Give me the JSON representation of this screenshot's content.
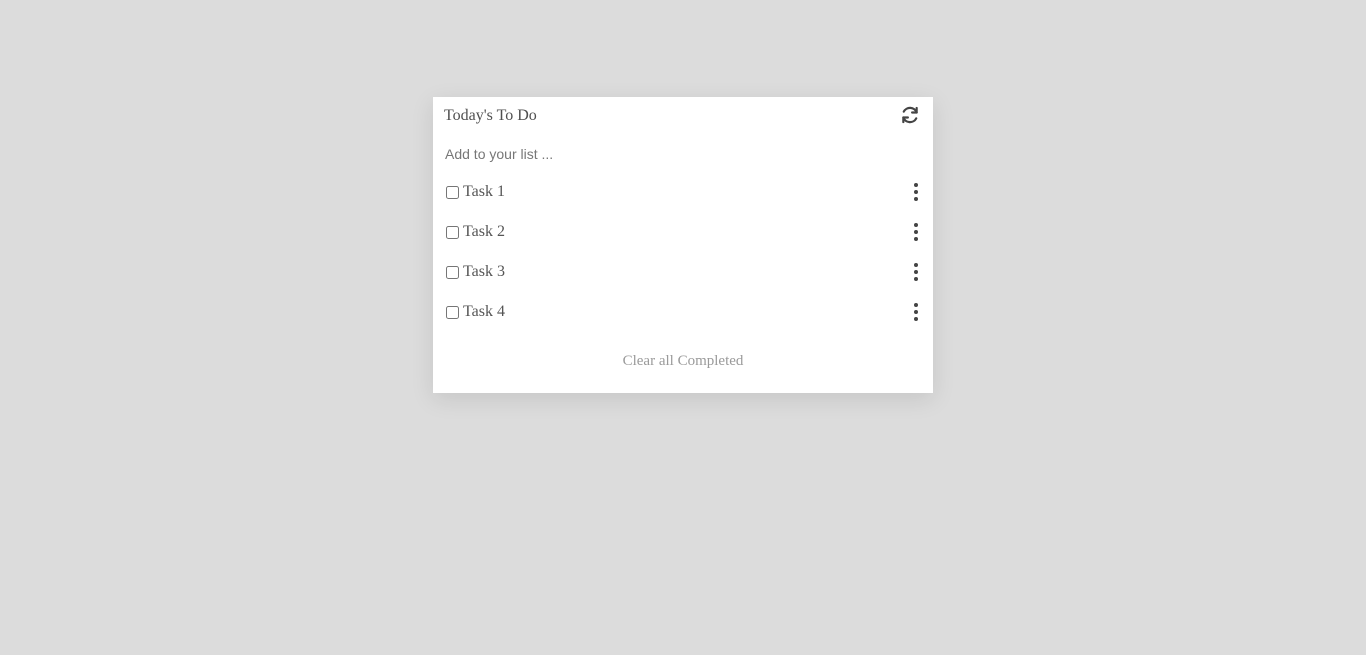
{
  "app": {
    "title": "Today's To Do",
    "refresh_icon": "refresh-icon"
  },
  "add": {
    "placeholder": "Add to your list ..."
  },
  "tasks": [
    {
      "label": "Task 1",
      "checked": false,
      "menu_icon": "kebab-menu-icon"
    },
    {
      "label": "Task 2",
      "checked": false,
      "menu_icon": "kebab-menu-icon"
    },
    {
      "label": "Task 3",
      "checked": false,
      "menu_icon": "kebab-menu-icon"
    },
    {
      "label": "Task 4",
      "checked": false,
      "menu_icon": "kebab-menu-icon"
    }
  ],
  "footer": {
    "clear_label": "Clear all Completed"
  },
  "colors": {
    "background": "#dcdcdc",
    "card": "#ffffff",
    "text": "#555555",
    "muted": "#9a9a9a",
    "icon": "#444444"
  }
}
